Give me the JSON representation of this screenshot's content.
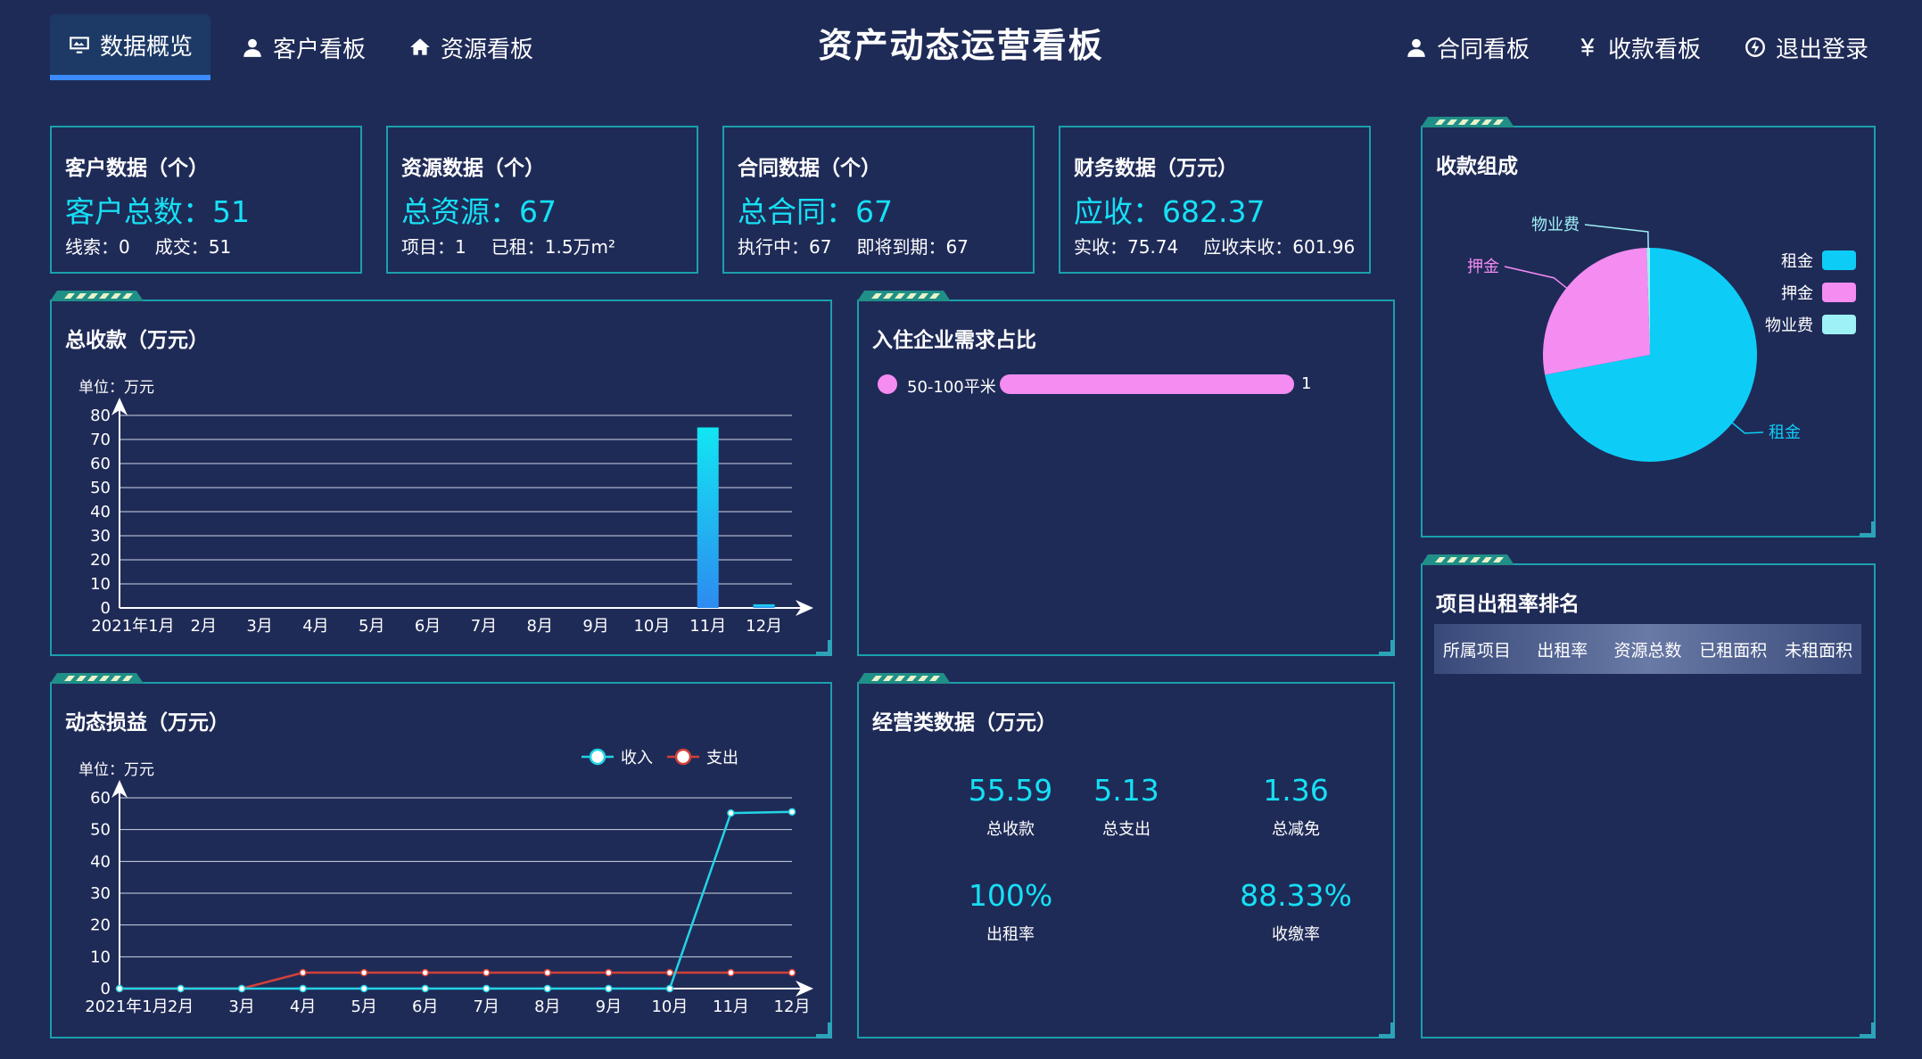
{
  "nav": {
    "left": [
      {
        "label": "数据概览",
        "icon": "monitor-icon",
        "active": true
      },
      {
        "label": "客户看板",
        "icon": "user-icon"
      },
      {
        "label": "资源看板",
        "icon": "home-icon"
      }
    ],
    "right": [
      {
        "label": "合同看板",
        "icon": "person-icon"
      },
      {
        "label": "收款看板",
        "icon": "yen-icon"
      },
      {
        "label": "退出登录",
        "icon": "logout-icon"
      }
    ]
  },
  "title": "资产动态运营看板",
  "stats": [
    {
      "title": "客户数据（个）",
      "big": "客户总数：51",
      "subs": [
        "线索：0",
        "成交：51"
      ]
    },
    {
      "title": "资源数据（个）",
      "big": "总资源：67",
      "subs": [
        "项目：1",
        "已租：1.5万m²"
      ]
    },
    {
      "title": "合同数据（个）",
      "big": "总合同：67",
      "subs": [
        "执行中：67",
        "即将到期：67"
      ]
    },
    {
      "title": "财务数据（万元）",
      "big": "应收：682.37",
      "subs": [
        "实收：75.74",
        "应收未收：601.96"
      ]
    }
  ],
  "panels": {
    "total_receipts": "总收款（万元）",
    "enterprise_demand": "入住企业需求占比",
    "dynamic_pl": "动态损益（万元）",
    "operating": "经营类数据（万元）",
    "receipt_composition": "收款组成",
    "occupancy_rank": "项目出租率排名"
  },
  "unit_label": "单位：万元",
  "demand": {
    "label": "50-100平米",
    "value": "1",
    "color": "#f48cf2"
  },
  "kpis": [
    {
      "value": "55.59",
      "label": "总收款"
    },
    {
      "value": "5.13",
      "label": "总支出"
    },
    {
      "value": "1.36",
      "label": "总减免"
    },
    {
      "value": "100%",
      "label": "出租率"
    },
    {
      "value": "88.33%",
      "label": "收缴率"
    }
  ],
  "table_headers": [
    "所属项目",
    "出租率",
    "资源总数",
    "已租面积",
    "未租面积"
  ],
  "chart_data": [
    {
      "type": "bar",
      "title": "总收款（万元）",
      "ylabel": "单位：万元",
      "categories": [
        "2021年1月",
        "2月",
        "3月",
        "4月",
        "5月",
        "6月",
        "7月",
        "8月",
        "9月",
        "10月",
        "11月",
        "12月"
      ],
      "values": [
        0,
        0,
        0,
        0,
        0,
        0,
        0,
        0,
        0,
        0,
        75,
        1.5
      ],
      "ylim": [
        0,
        80
      ],
      "yticks": [
        0,
        10,
        20,
        30,
        40,
        50,
        60,
        70,
        80
      ],
      "grid": true
    },
    {
      "type": "line",
      "title": "动态损益（万元）",
      "ylabel": "单位：万元",
      "categories": [
        "2021年1月",
        "2月",
        "3月",
        "4月",
        "5月",
        "6月",
        "7月",
        "8月",
        "9月",
        "10月",
        "11月",
        "12月"
      ],
      "series": [
        {
          "name": "收入",
          "values": [
            0,
            0,
            0,
            0,
            0,
            0,
            0,
            0,
            0,
            0,
            55.2,
            55.6
          ],
          "color": "#22d3e6"
        },
        {
          "name": "支出",
          "values": [
            0,
            0,
            0,
            5,
            5,
            5,
            5,
            5,
            5,
            5,
            5,
            5
          ],
          "color": "#d2403a"
        }
      ],
      "ylim": [
        0,
        60
      ],
      "yticks": [
        0,
        10,
        20,
        30,
        40,
        50,
        60
      ],
      "legend": "top-right",
      "grid": true
    },
    {
      "type": "pie",
      "title": "收款组成",
      "slices": [
        {
          "label": "租金",
          "value": 72,
          "color": "#0dcdf7"
        },
        {
          "label": "押金",
          "value": 27.5,
          "color": "#f48cf2"
        },
        {
          "label": "物业费",
          "value": 0.5,
          "color": "#9ef2f7"
        }
      ],
      "legend": "right"
    }
  ]
}
